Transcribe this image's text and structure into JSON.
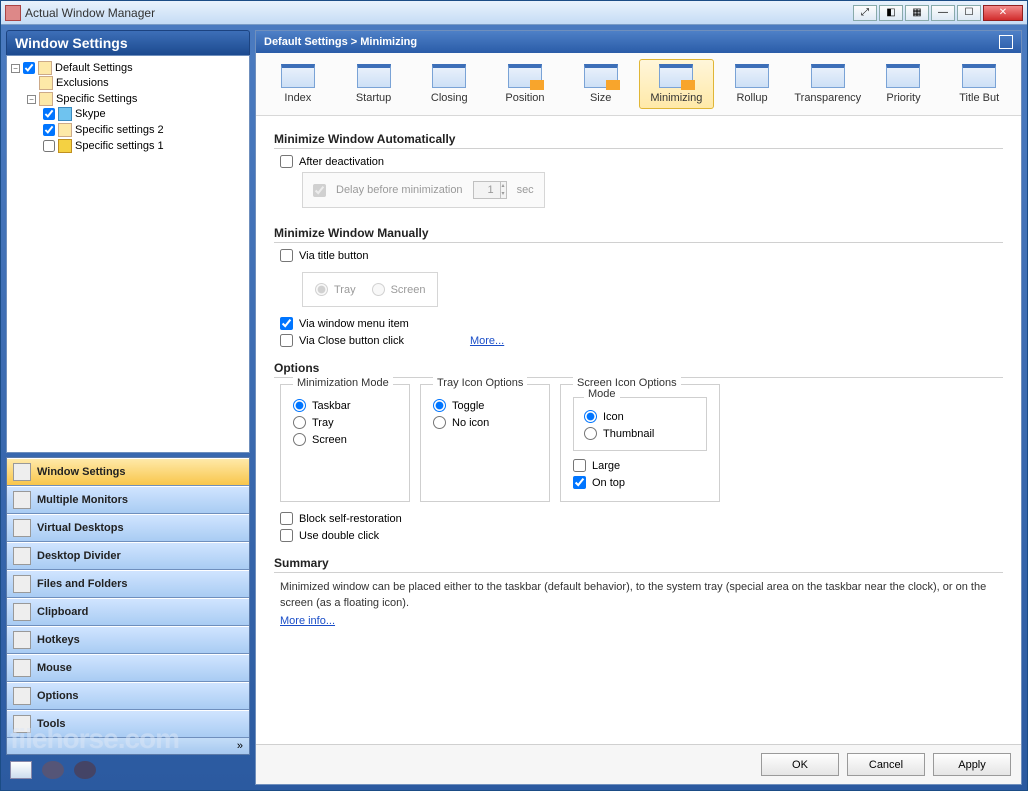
{
  "window": {
    "title": "Actual Window Manager"
  },
  "titlebar_buttons": [
    "⤢",
    "◧",
    "▦",
    "—",
    "☐",
    "✕"
  ],
  "sidebar": {
    "header": "Window Settings",
    "tree": {
      "root": "Default Settings",
      "exclusions": "Exclusions",
      "specific": "Specific Settings",
      "items": [
        "Skype",
        "Specific settings 2",
        "Specific settings 1"
      ]
    },
    "nav": [
      "Window Settings",
      "Multiple Monitors",
      "Virtual Desktops",
      "Desktop Divider",
      "Files and Folders",
      "Clipboard",
      "Hotkeys",
      "Mouse",
      "Options",
      "Tools"
    ],
    "expand_glyph": "»"
  },
  "main": {
    "breadcrumb": "Default Settings > Minimizing",
    "tabs": [
      "Index",
      "Startup",
      "Closing",
      "Position",
      "Size",
      "Minimizing",
      "Rollup",
      "Transparency",
      "Priority",
      "Title But"
    ],
    "selected_tab": "Minimizing",
    "sec_auto": {
      "title": "Minimize Window Automatically",
      "after_deactivation": "After deactivation",
      "delay_label": "Delay before minimization",
      "delay_value": "1",
      "delay_unit": "sec"
    },
    "sec_manual": {
      "title": "Minimize Window Manually",
      "via_title": "Via title button",
      "tray": "Tray",
      "screen": "Screen",
      "via_menu": "Via window menu item",
      "via_close": "Via Close button click",
      "more": "More..."
    },
    "sec_options": {
      "title": "Options",
      "min_mode": {
        "legend": "Minimization Mode",
        "taskbar": "Taskbar",
        "tray": "Tray",
        "screen": "Screen"
      },
      "tray_opts": {
        "legend": "Tray Icon Options",
        "toggle": "Toggle",
        "noicon": "No icon"
      },
      "screen_opts": {
        "legend": "Screen Icon Options",
        "mode_legend": "Mode",
        "icon": "Icon",
        "thumbnail": "Thumbnail",
        "large": "Large",
        "ontop": "On top"
      },
      "block_self": "Block self-restoration",
      "double_click": "Use double click"
    },
    "sec_summary": {
      "title": "Summary",
      "text": "Minimized window can be placed either to the taskbar (default behavior), to the system tray (special area on the taskbar near the clock), or on the screen (as a floating icon).",
      "more": "More info..."
    }
  },
  "footer": {
    "ok": "OK",
    "cancel": "Cancel",
    "apply": "Apply"
  },
  "watermark": "filehorse.com"
}
